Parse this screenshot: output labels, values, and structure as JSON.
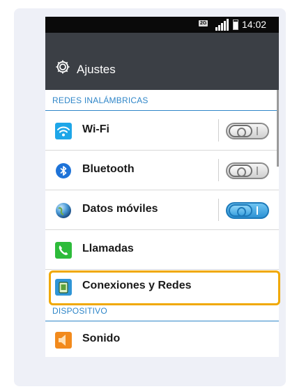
{
  "statusbar": {
    "network_badge": "2G",
    "time": "14:02"
  },
  "actionbar": {
    "title": "Ajustes",
    "icon": "gear-icon"
  },
  "sections": {
    "wireless_header": "REDES INALÁMBRICAS",
    "device_header": "DISPOSITIVO"
  },
  "rows": [
    {
      "label": "Wi-Fi",
      "icon": "wifi-icon",
      "toggle": "off"
    },
    {
      "label": "Bluetooth",
      "icon": "bluetooth-icon",
      "toggle": "off"
    },
    {
      "label": "Datos móviles",
      "icon": "globe-icon",
      "toggle": "on"
    },
    {
      "label": "Llamadas",
      "icon": "phone-icon"
    },
    {
      "label": "Conexiones y Redes",
      "icon": "network-icon"
    },
    {
      "label": "Sonido",
      "icon": "speaker-icon"
    }
  ],
  "colors": {
    "accent": "#2f86c8",
    "highlight": "#f0a800",
    "actionbar": "#3b3f45"
  }
}
